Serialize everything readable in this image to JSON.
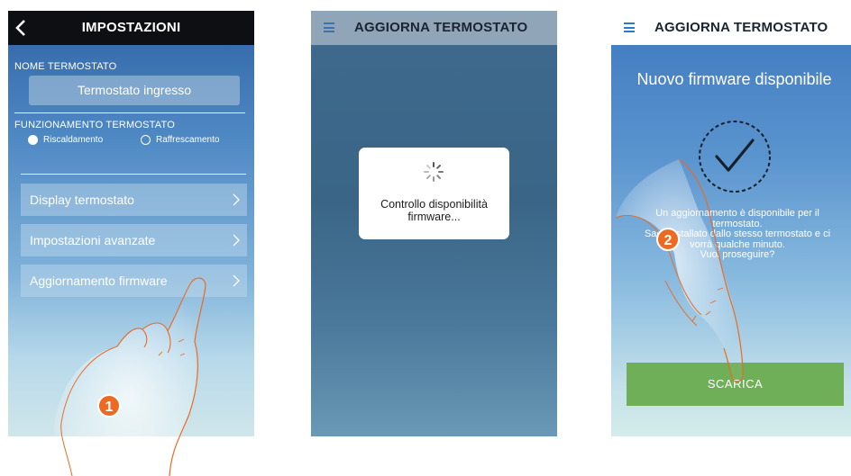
{
  "screen1": {
    "title": "IMPOSTAZIONI",
    "back_icon": "chevron-left-icon",
    "name_label": "NOME TERMOSTATO",
    "name_value": "Termostato ingresso",
    "mode_label": "FUNZIONAMENTO TERMOSTATO",
    "modes": [
      {
        "label": "Riscaldamento",
        "selected": true
      },
      {
        "label": "Raffrescamento",
        "selected": false
      }
    ],
    "menu": [
      {
        "label": "Display termostato"
      },
      {
        "label": "Impostazioni avanzate"
      },
      {
        "label": "Aggiornamento firmware"
      }
    ],
    "step_badge": "1"
  },
  "screen2": {
    "title": "AGGIORNA TERMOSTATO",
    "menu_icon": "hamburger-menu-icon",
    "dialog_line1": "Controllo disponibilità",
    "dialog_line2": "firmware...",
    "spinner_icon": "loading-spinner-icon"
  },
  "screen3": {
    "title": "AGGIORNA TERMOSTATO",
    "menu_icon": "hamburger-menu-icon",
    "heading": "Nuovo firmware disponibile",
    "check_icon": "checkmark-circle-icon",
    "info_lines": [
      "Un aggiornamento è disponibile per il",
      "termostato.",
      "Sarà installato dallo stesso termostato e ci",
      "vorrà qualche minuto.",
      "Vuoi proseguire?"
    ],
    "download_button": "SCARICA",
    "step_badge": "2"
  },
  "colors": {
    "accent_orange": "#ec6a22",
    "button_green": "#6faf58",
    "dark_bar": "#0e0f12"
  }
}
